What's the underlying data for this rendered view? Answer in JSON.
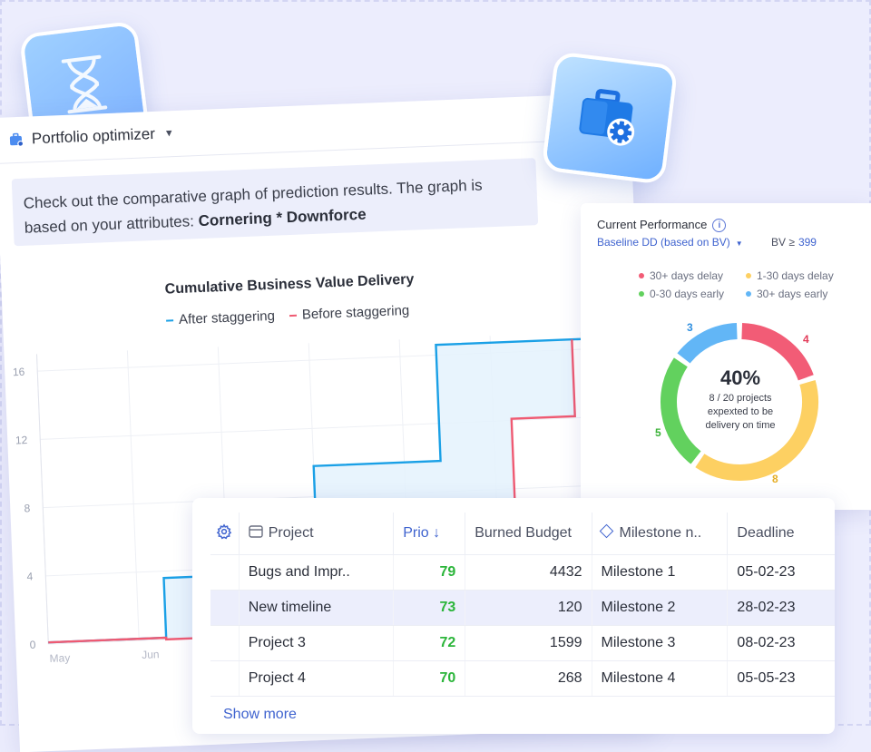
{
  "colors": {
    "accent_blue": "#3f63cf",
    "after_line": "#1aa0e6",
    "before_line": "#ef5a72",
    "green_prio": "#2bb53a",
    "delay_30plus": "#f25c76",
    "delay_1_30": "#fdd062",
    "early_0_30": "#62d15e",
    "early_30plus": "#62b6f6"
  },
  "tiles": {
    "left_icon": "hourglass-icon",
    "right_icon": "briefcase-gear-icon"
  },
  "header": {
    "title": "Portfolio optimizer"
  },
  "info": {
    "text": "Check out the comparative graph of prediction results. The graph is based on your attributes:",
    "attributes": "Cornering * Downforce"
  },
  "chart": {
    "title": "Cumulative Business Value Delivery",
    "legend_after": "After staggering",
    "legend_before": "Before staggering"
  },
  "chart_data": {
    "type": "line",
    "title": "Cumulative Business Value Delivery",
    "x_ticks": [
      "May",
      "Jun"
    ],
    "y_ticks": [
      "0",
      "4",
      "8",
      "12",
      "16"
    ],
    "ylim": [
      0,
      17
    ],
    "grid": true,
    "legend_placement": "top",
    "series": [
      {
        "name": "After staggering",
        "points": [
          [
            0,
            0.1
          ],
          [
            1.3,
            0.1
          ],
          [
            1.3,
            3.6
          ],
          [
            3,
            3.6
          ],
          [
            3,
            9.8
          ],
          [
            4.4,
            9.8
          ],
          [
            4.4,
            16.6
          ],
          [
            6.1,
            16.6
          ]
        ]
      },
      {
        "name": "Before staggering",
        "points": [
          [
            0,
            0.1
          ],
          [
            1.3,
            0.1
          ],
          [
            1.3,
            0
          ],
          [
            5.2,
            0
          ],
          [
            5.2,
            12.1
          ],
          [
            5.9,
            12.1
          ],
          [
            5.9,
            16.6
          ]
        ]
      }
    ]
  },
  "performance": {
    "title": "Current Performance",
    "baseline": "Baseline DD (based on BV)",
    "bv_label": "BV ≥",
    "bv_value": "399",
    "legend": [
      "30+ days delay",
      "1-30 days delay",
      "0-30 days early",
      "30+ days early"
    ],
    "percent": "40%",
    "line1": "8 / 20 projects",
    "line2": "expexted to be",
    "line3": "delivery on time",
    "segments": [
      {
        "label": "4",
        "value": 4,
        "color": "#f25c76"
      },
      {
        "label": "8",
        "value": 8,
        "color": "#fdd062"
      },
      {
        "label": "5",
        "value": 5,
        "color": "#62d15e"
      },
      {
        "label": "3",
        "value": 3,
        "color": "#62b6f6"
      }
    ]
  },
  "table": {
    "headers": {
      "project": "Project",
      "prio": "Prio ↓",
      "budget": "Burned Budget",
      "milestone": "Milestone n..",
      "deadline": "Deadline"
    },
    "rows": [
      {
        "project": "Bugs and Impr..",
        "prio": "79",
        "budget": "4432",
        "milestone": "Milestone 1",
        "deadline": "05-02-23"
      },
      {
        "project": "New timeline",
        "prio": "73",
        "budget": "120",
        "milestone": "Milestone 2",
        "deadline": "28-02-23"
      },
      {
        "project": "Project 3",
        "prio": "72",
        "budget": "1599",
        "milestone": "Milestone 3",
        "deadline": "08-02-23"
      },
      {
        "project": "Project 4",
        "prio": "70",
        "budget": "268",
        "milestone": "Milestone 4",
        "deadline": "05-05-23"
      }
    ],
    "show_more": "Show more"
  }
}
